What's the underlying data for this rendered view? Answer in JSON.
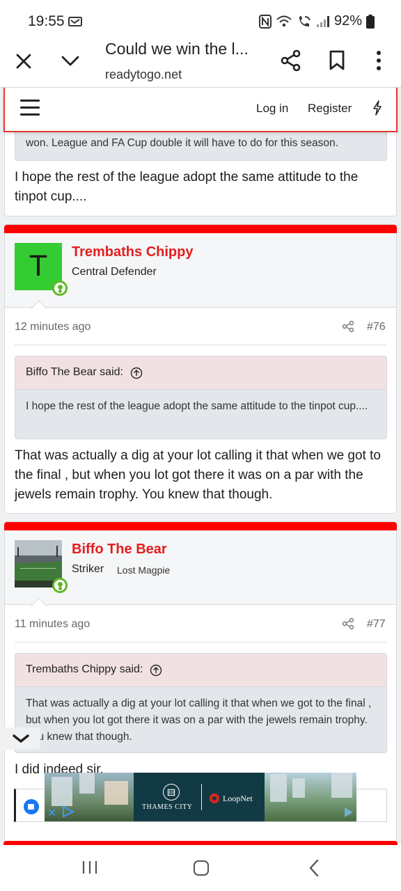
{
  "status_bar": {
    "time": "19:55",
    "battery": "92%"
  },
  "browser": {
    "title": "Could we win the l...",
    "url": "readytogo.net"
  },
  "header": {
    "login": "Log in",
    "register": "Register"
  },
  "prev_post": {
    "quote_tail": "won. League and FA Cup double it will have to do for this season.",
    "text": "I hope the rest of the league adopt the same attitude to the tinpot cup...."
  },
  "posts": [
    {
      "avatar_letter": "T",
      "username": "Trembaths Chippy",
      "user_title": "Central Defender",
      "time": "12 minutes ago",
      "number": "#76",
      "quote_author": "Biffo The Bear said:",
      "quote_text": "I hope the rest of the league adopt the same attitude to the tinpot cup....",
      "text": "That was actually a dig at your lot calling it that when we got to the final , but when you lot got there it was on a par with the jewels remain trophy. You knew that though."
    },
    {
      "username": "Biffo The Bear",
      "user_title": "Striker",
      "user_banner": "Lost Magpie",
      "time": "11 minutes ago",
      "number": "#77",
      "quote_author": "Trembaths Chippy said:",
      "quote_text": "That was actually a dig at your lot calling it that when we got to the final , but when you lot got there it was on a par with the jewels remain trophy. You knew that though.",
      "text": "I did indeed sir."
    }
  ],
  "ad": {
    "brand1": "THAMES CITY",
    "brand2": "LoopNet"
  },
  "colors": {
    "accent": "#ff0000",
    "username": "#e21e1e",
    "online": "#63b728",
    "avatar_bg": "#35cc33"
  }
}
